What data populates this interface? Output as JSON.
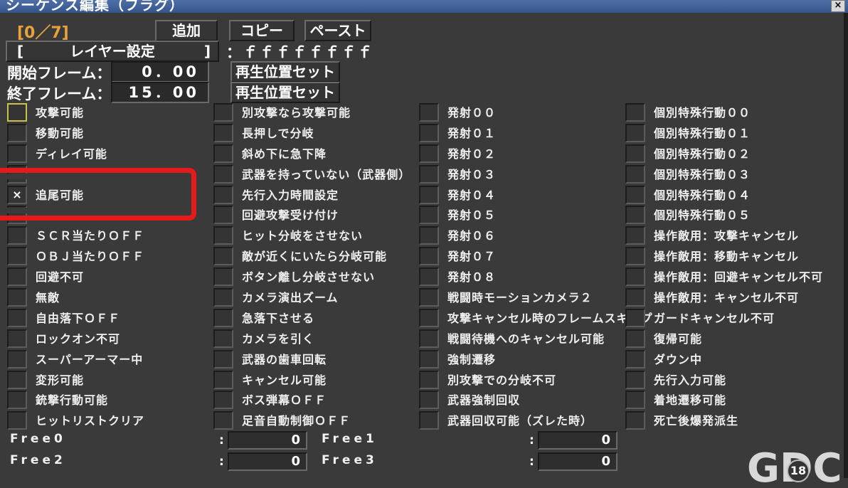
{
  "window": {
    "title": "シーケンス編集（フラグ）",
    "close_glyph": "×"
  },
  "toolbar": {
    "counter": "[0／7]",
    "add": "追加",
    "copy": "コピー",
    "paste": "ペースト"
  },
  "layer": {
    "bracket_open": "[",
    "label": "レイヤー設定",
    "bracket_close": "]",
    "mask": "：ｆｆｆｆｆｆｆｆ"
  },
  "frames": {
    "start_label": "開始フレーム：",
    "start_value": "0．00",
    "start_button": "再生位置セット",
    "end_label": "終了フレーム：",
    "end_value": "15．00",
    "end_button": "再生位置セット"
  },
  "flags": [
    [
      {
        "label": "攻撃可能",
        "checked": false
      },
      {
        "label": "移動可能",
        "checked": false
      },
      {
        "label": "ディレイ可能",
        "checked": false
      },
      {
        "label": "",
        "checked": false
      },
      {
        "label": "追尾可能",
        "checked": true
      },
      {
        "label": "",
        "checked": false
      },
      {
        "label": "ＳＣＲ当たりＯＦＦ",
        "checked": false
      },
      {
        "label": "ＯＢＪ当たりＯＦＦ",
        "checked": false
      },
      {
        "label": "回避不可",
        "checked": false
      },
      {
        "label": "無敵",
        "checked": false
      },
      {
        "label": "自由落下ＯＦＦ",
        "checked": false
      },
      {
        "label": "ロックオン不可",
        "checked": false
      },
      {
        "label": "スーパーアーマー中",
        "checked": false
      },
      {
        "label": "変形可能",
        "checked": false
      },
      {
        "label": "銃撃行動可能",
        "checked": false
      },
      {
        "label": "ヒットリストクリア",
        "checked": false
      }
    ],
    [
      {
        "label": "別攻撃なら攻撃可能",
        "checked": false
      },
      {
        "label": "長押しで分岐",
        "checked": false
      },
      {
        "label": "斜め下に急下降",
        "checked": false
      },
      {
        "label": "武器を持っていない（武器側）",
        "checked": false
      },
      {
        "label": "先行入力時間設定",
        "checked": false
      },
      {
        "label": "回避攻撃受け付け",
        "checked": false
      },
      {
        "label": "ヒット分岐をさせない",
        "checked": false
      },
      {
        "label": "敵が近くにいたら分岐可能",
        "checked": false
      },
      {
        "label": "ボタン離し分岐させない",
        "checked": false
      },
      {
        "label": "カメラ演出ズーム",
        "checked": false
      },
      {
        "label": "急落下させる",
        "checked": false
      },
      {
        "label": "カメラを引く",
        "checked": false
      },
      {
        "label": "武器の歯車回転",
        "checked": false
      },
      {
        "label": "キャンセル可能",
        "checked": false
      },
      {
        "label": "ボス弾幕ＯＦＦ",
        "checked": false
      },
      {
        "label": "足音自動制御ＯＦＦ",
        "checked": false
      }
    ],
    [
      {
        "label": "発射００",
        "checked": false
      },
      {
        "label": "発射０１",
        "checked": false
      },
      {
        "label": "発射０２",
        "checked": false
      },
      {
        "label": "発射０３",
        "checked": false
      },
      {
        "label": "発射０４",
        "checked": false
      },
      {
        "label": "発射０５",
        "checked": false
      },
      {
        "label": "発射０６",
        "checked": false
      },
      {
        "label": "発射０７",
        "checked": false
      },
      {
        "label": "発射０８",
        "checked": false
      },
      {
        "label": "戦闘時モーションカメラ２",
        "checked": false
      },
      {
        "label": "攻撃キャンセル時のフレームスキップ",
        "checked": false
      },
      {
        "label": "戦闘待機へのキャンセル可能",
        "checked": false
      },
      {
        "label": "強制遷移",
        "checked": false
      },
      {
        "label": "別攻撃での分岐不可",
        "checked": false
      },
      {
        "label": "武器強制回収",
        "checked": false
      },
      {
        "label": "武器回収可能（ズレた時）",
        "checked": false
      }
    ],
    [
      {
        "label": "個別特殊行動００",
        "checked": false
      },
      {
        "label": "個別特殊行動０１",
        "checked": false
      },
      {
        "label": "個別特殊行動０２",
        "checked": false
      },
      {
        "label": "個別特殊行動０３",
        "checked": false
      },
      {
        "label": "個別特殊行動０４",
        "checked": false
      },
      {
        "label": "個別特殊行動０５",
        "checked": false
      },
      {
        "label": "操作敵用：攻撃キャンセル",
        "checked": false
      },
      {
        "label": "操作敵用：移動キャンセル",
        "checked": false
      },
      {
        "label": "操作敵用：回避キャンセル不可",
        "checked": false
      },
      {
        "label": "操作敵用：キャンセル不可",
        "checked": false
      },
      {
        "label": "ガードキャンセル不可",
        "checked": false
      },
      {
        "label": "復帰可能",
        "checked": false
      },
      {
        "label": "ダウン中",
        "checked": false
      },
      {
        "label": "先行入力可能",
        "checked": false
      },
      {
        "label": "着地遷移可能",
        "checked": false
      },
      {
        "label": "死亡後爆発派生",
        "checked": false
      }
    ]
  ],
  "free": {
    "free0_label": "Free0",
    "free0_value": "0",
    "free1_label": "Free1",
    "free1_value": "0",
    "free2_label": "Free2",
    "free2_value": "0",
    "free3_label": "Free3",
    "free3_value": "0",
    "colon": ":"
  },
  "watermark": {
    "logo": "GDC",
    "badge": "18"
  },
  "colors": {
    "accent_counter": "#e8a23a",
    "highlight": "#e51a1a",
    "background": "#3a3a3a"
  }
}
